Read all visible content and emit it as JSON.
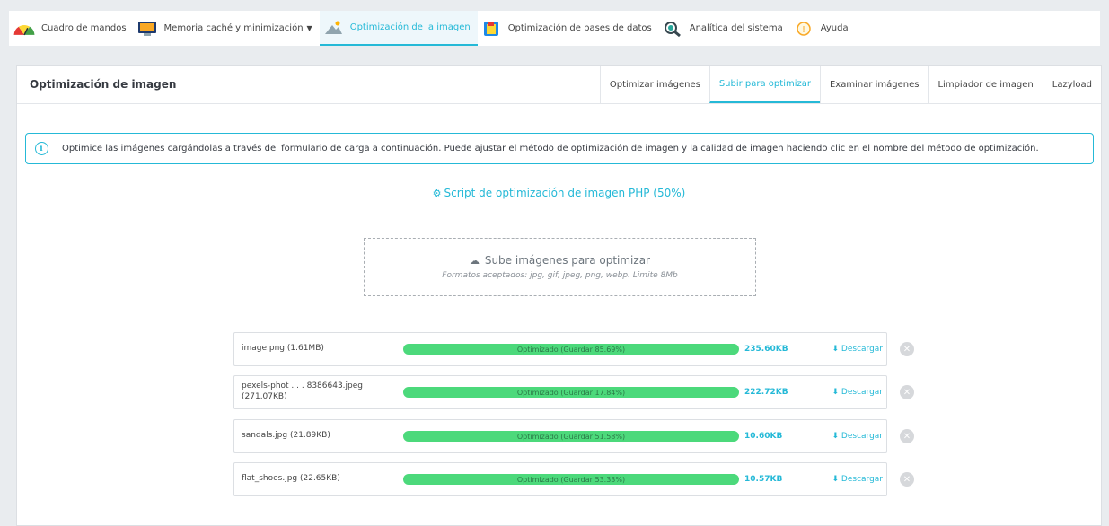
{
  "nav": {
    "items": [
      {
        "label": "Cuadro de mandos",
        "icon": "dashboard-gauge-icon"
      },
      {
        "label": "Memoria caché y minimización",
        "icon": "cache-monitor-icon"
      },
      {
        "label": "Optimización de la imagen",
        "icon": "image-optimization-icon"
      },
      {
        "label": "Optimización de bases de datos",
        "icon": "database-icon"
      },
      {
        "label": "Analítica del sistema",
        "icon": "analytics-icon"
      },
      {
        "label": "Ayuda",
        "icon": "help-icon"
      }
    ],
    "active_index": 2
  },
  "panel": {
    "title": "Optimización de imagen",
    "tabs": [
      "Optimizar imágenes",
      "Subir para optimizar",
      "Examinar imágenes",
      "Limpiador de imagen",
      "Lazyload"
    ],
    "active_tab": 1
  },
  "alert": {
    "text": "Optimice las imágenes cargándolas a través del formulario de carga a continuación. Puede ajustar el método de optimización de imagen y la calidad de imagen haciendo clic en el nombre del método de optimización."
  },
  "method": {
    "label": "Script de optimización de imagen PHP (50%)"
  },
  "dropzone": {
    "title": "Sube imágenes para optimizar",
    "subtitle": "Formatos aceptados: jpg, gif, jpeg, png, webp. Limite 8Mb"
  },
  "files": [
    {
      "name": "image.png (1.61MB)",
      "status": "Optimizado (Guardar 85.69%)",
      "progress": 100,
      "size": "235.60KB",
      "download": "Descargar"
    },
    {
      "name": "pexels-phot . . . 8386643.jpeg (271.07KB)",
      "status": "Optimizado (Guardar 17.84%)",
      "progress": 100,
      "size": "222.72KB",
      "download": "Descargar"
    },
    {
      "name": "sandals.jpg (21.89KB)",
      "status": "Optimizado (Guardar 51.58%)",
      "progress": 100,
      "size": "10.60KB",
      "download": "Descargar"
    },
    {
      "name": "flat_shoes.jpg (22.65KB)",
      "status": "Optimizado (Guardar 53.33%)",
      "progress": 100,
      "size": "10.57KB",
      "download": "Descargar"
    }
  ],
  "colors": {
    "accent": "#25b9d7",
    "progress": "#4cd97b"
  }
}
